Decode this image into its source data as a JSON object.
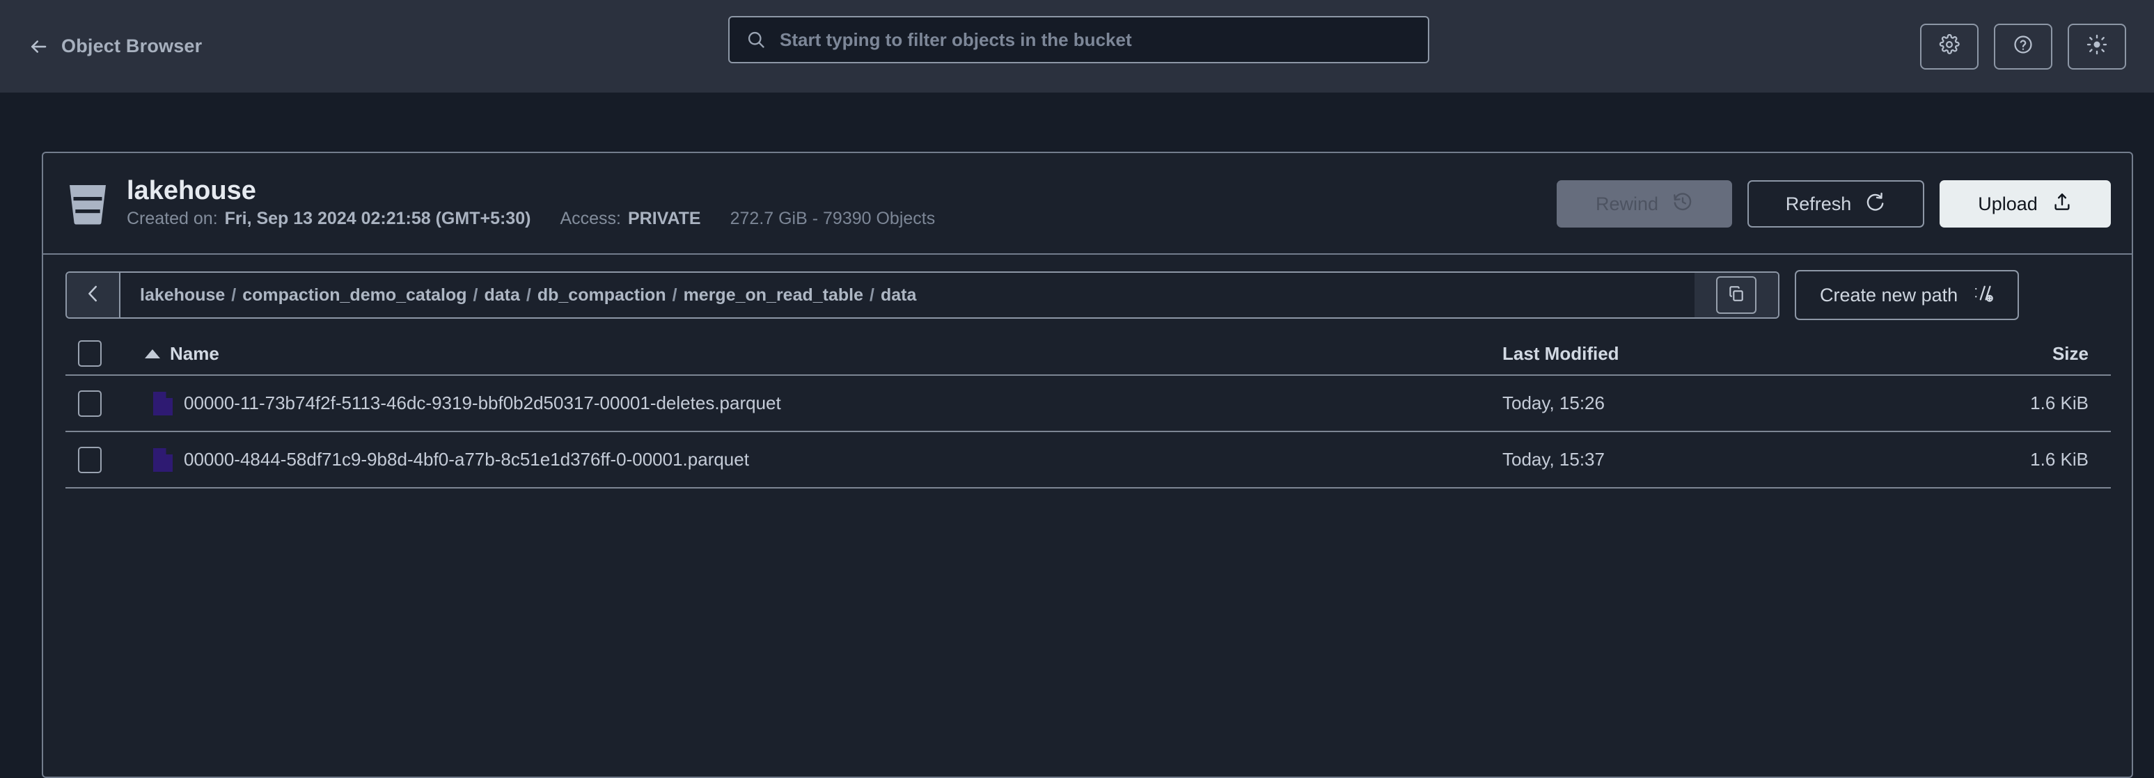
{
  "topbar": {
    "back_label": "Object Browser",
    "back_icon": "arrow-left-icon",
    "search": {
      "placeholder": "Start typing to filter objects in the bucket",
      "value": "",
      "icon": "search-icon"
    },
    "actions": [
      {
        "name": "settings-button",
        "icon": "gear-icon"
      },
      {
        "name": "help-button",
        "icon": "question-circle-icon"
      },
      {
        "name": "theme-toggle-button",
        "icon": "sun-icon"
      }
    ]
  },
  "bucket": {
    "icon": "bucket-icon",
    "name": "lakehouse",
    "created_label": "Created on:",
    "created_value": "Fri, Sep 13 2024 02:21:58 (GMT+5:30)",
    "access_label": "Access:",
    "access_value": "PRIVATE",
    "usage": "272.7 GiB - 79390 Objects"
  },
  "header_actions": {
    "rewind": {
      "label": "Rewind",
      "icon": "rewind-clock-icon",
      "disabled": true
    },
    "refresh": {
      "label": "Refresh",
      "icon": "refresh-icon",
      "disabled": false
    },
    "upload": {
      "label": "Upload",
      "icon": "upload-icon",
      "disabled": false
    }
  },
  "breadcrumb": {
    "back_icon": "chevron-left-icon",
    "segments": [
      "lakehouse",
      "compaction_demo_catalog",
      "data",
      "db_compaction",
      "merge_on_read_table",
      "data"
    ],
    "separator": "/",
    "copy_icon": "copy-icon",
    "create_path": {
      "label": "Create new path",
      "icon": "new-path-icon"
    }
  },
  "table": {
    "columns": {
      "name": "Name",
      "last_modified": "Last Modified",
      "size": "Size"
    },
    "sort": {
      "column": "Name",
      "direction": "asc"
    },
    "select_all_checked": false,
    "rows": [
      {
        "name": "00000-11-73b74f2f-5113-46dc-9319-bbf0b2d50317-00001-deletes.parquet",
        "last_modified": "Today, 15:26",
        "size": "1.6 KiB",
        "icon": "parquet-file-icon",
        "checked": false
      },
      {
        "name": "00000-4844-58df71c9-9b8d-4bf0-a77b-8c51e1d376ff-0-00001.parquet",
        "last_modified": "Today, 15:37",
        "size": "1.6 KiB",
        "icon": "parquet-file-icon",
        "checked": false
      }
    ]
  },
  "colors": {
    "page_bg": "#161c27",
    "topbar_bg": "#2b313e",
    "panel_bg": "#1b212c",
    "border": "#737d8d",
    "text_primary": "#e6eaf0",
    "text_secondary": "#a7b0be",
    "upload_bg": "#e9eef0",
    "file_icon": "#2e1a72"
  }
}
